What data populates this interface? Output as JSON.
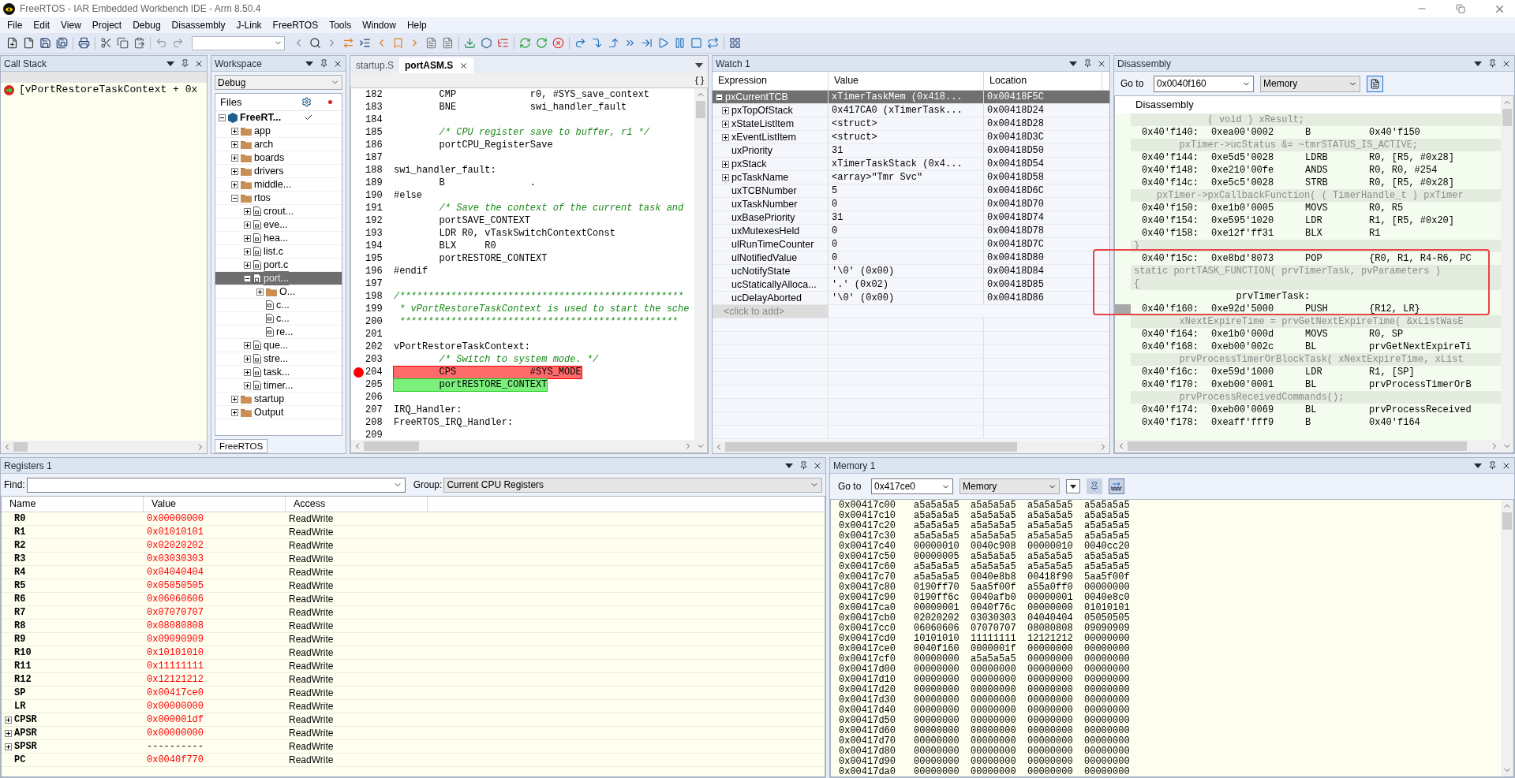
{
  "window": {
    "title": "FreeRTOS - IAR Embedded Workbench IDE - Arm 8.50.4"
  },
  "menu": [
    "File",
    "Edit",
    "View",
    "Project",
    "Debug",
    "Disassembly",
    "J-Link",
    "FreeRTOS",
    "Tools",
    "Window",
    "Help"
  ],
  "call_stack": {
    "title": "Call Stack",
    "frames": [
      "[vPortRestoreTaskContext + 0x"
    ]
  },
  "workspace": {
    "title": "Workspace",
    "config": "Debug",
    "column": "Files",
    "tab": "FreeRTOS",
    "tree": [
      {
        "label": "FreeRT...",
        "kind": "project",
        "expanded": true,
        "checked": true,
        "selected": false,
        "children": [
          {
            "label": "app",
            "kind": "folder",
            "expanded": false,
            "selected": false
          },
          {
            "label": "arch",
            "kind": "folder",
            "expanded": false,
            "selected": false
          },
          {
            "label": "boards",
            "kind": "folder",
            "expanded": false,
            "selected": false
          },
          {
            "label": "drivers",
            "kind": "folder",
            "expanded": false,
            "selected": false
          },
          {
            "label": "middle...",
            "kind": "folder",
            "expanded": false,
            "selected": false
          },
          {
            "label": "rtos",
            "kind": "folder",
            "expanded": true,
            "selected": false,
            "children": [
              {
                "label": "crout...",
                "kind": "source",
                "expanded": false,
                "selected": false
              },
              {
                "label": "eve...",
                "kind": "source",
                "expanded": false,
                "selected": false
              },
              {
                "label": "hea...",
                "kind": "source",
                "expanded": false,
                "selected": false
              },
              {
                "label": "list.c",
                "kind": "source",
                "expanded": false,
                "selected": false
              },
              {
                "label": "port.c",
                "kind": "source",
                "expanded": false,
                "selected": false
              },
              {
                "label": "port...",
                "kind": "asm",
                "expanded": true,
                "selected": true,
                "children": [
                  {
                    "label": "O...",
                    "kind": "folder",
                    "expanded": false,
                    "selected": false
                  },
                  {
                    "label": "c...",
                    "kind": "header",
                    "selected": false
                  },
                  {
                    "label": "c...",
                    "kind": "header",
                    "selected": false
                  },
                  {
                    "label": "re...",
                    "kind": "header",
                    "selected": false
                  }
                ]
              },
              {
                "label": "que...",
                "kind": "source",
                "expanded": false,
                "selected": false
              },
              {
                "label": "stre...",
                "kind": "source",
                "expanded": false,
                "selected": false
              },
              {
                "label": "task...",
                "kind": "source",
                "expanded": false,
                "selected": false
              },
              {
                "label": "timer...",
                "kind": "source",
                "expanded": false,
                "selected": false
              }
            ]
          },
          {
            "label": "startup",
            "kind": "folder",
            "expanded": false,
            "selected": false
          },
          {
            "label": "Output",
            "kind": "folder",
            "expanded": false,
            "selected": false
          }
        ]
      }
    ]
  },
  "editor": {
    "tabs": [
      {
        "label": "startup.S",
        "selected": false
      },
      {
        "label": "portASM.S",
        "selected": true
      }
    ],
    "lines": [
      {
        "num": "182",
        "kind": "code",
        "breakpoint": false,
        "text": "        CMP             r0, #SYS_save_context"
      },
      {
        "num": "183",
        "kind": "code",
        "breakpoint": false,
        "text": "        BNE             swi_handler_fault"
      },
      {
        "num": "184",
        "breakpoint": false
      },
      {
        "num": "185",
        "kind": "comment",
        "breakpoint": false,
        "text": "        /* CPU register save to buffer, r1 */"
      },
      {
        "num": "186",
        "kind": "code",
        "breakpoint": false,
        "text": "        portCPU_RegisterSave"
      },
      {
        "num": "187",
        "breakpoint": false
      },
      {
        "num": "188",
        "kind": "code",
        "breakpoint": false,
        "text": "swi_handler_fault:"
      },
      {
        "num": "189",
        "kind": "code",
        "breakpoint": false,
        "text": "        B               ."
      },
      {
        "num": "190",
        "kind": "code",
        "breakpoint": false,
        "text": "#else"
      },
      {
        "num": "191",
        "kind": "comment",
        "breakpoint": false,
        "text": "        /* Save the context of the current task and"
      },
      {
        "num": "192",
        "kind": "code",
        "breakpoint": false,
        "text": "        portSAVE_CONTEXT"
      },
      {
        "num": "193",
        "kind": "code",
        "breakpoint": false,
        "text": "        LDR R0, vTaskSwitchContextConst"
      },
      {
        "num": "194",
        "kind": "code",
        "breakpoint": false,
        "text": "        BLX     R0"
      },
      {
        "num": "195",
        "kind": "code",
        "breakpoint": false,
        "text": "        portRESTORE_CONTEXT"
      },
      {
        "num": "196",
        "kind": "code",
        "breakpoint": false,
        "text": "#endif"
      },
      {
        "num": "197",
        "breakpoint": false
      },
      {
        "num": "198",
        "kind": "comment",
        "breakpoint": false,
        "text": "/**************************************************"
      },
      {
        "num": "199",
        "kind": "comment",
        "breakpoint": false,
        "text": " * vPortRestoreTaskContext is used to start the sche"
      },
      {
        "num": "200",
        "kind": "comment",
        "breakpoint": false,
        "text": " *************************************************"
      },
      {
        "num": "201",
        "breakpoint": false
      },
      {
        "num": "202",
        "kind": "code",
        "breakpoint": false,
        "text": "vPortRestoreTaskContext:"
      },
      {
        "num": "203",
        "kind": "comment",
        "breakpoint": false,
        "text": "        /* Switch to system mode. */"
      },
      {
        "num": "204",
        "kind": "code",
        "breakpoint": true,
        "current": false,
        "text": "        CPS             #SYS_MODE"
      },
      {
        "num": "205",
        "kind": "code",
        "breakpoint": false,
        "current": true,
        "text": "        portRESTORE_CONTEXT"
      },
      {
        "num": "206",
        "breakpoint": false
      },
      {
        "num": "207",
        "kind": "code",
        "breakpoint": false,
        "text": "IRQ_Handler:"
      },
      {
        "num": "208",
        "kind": "code",
        "breakpoint": false,
        "text": "FreeRTOS_IRQ_Handler:"
      },
      {
        "num": "209",
        "breakpoint": false
      }
    ]
  },
  "watch": {
    "title": "Watch 1",
    "columns": [
      "Expression",
      "Value",
      "Location"
    ],
    "add_row": "<click to add>",
    "rows": [
      {
        "expression": "pxCurrentTCB",
        "value": "xTimerTaskMem (0x418...",
        "location": "0x00418F5C",
        "expanded": true,
        "selected": true,
        "children": [
          {
            "expression": "pxTopOfStack",
            "value": "0x417CA0 (xTimerTask...",
            "location": "0x00418D24",
            "expanded": false,
            "selected": false
          },
          {
            "expression": "xStateListItem",
            "value": "<struct>",
            "location": "0x00418D28",
            "expanded": false,
            "selected": false
          },
          {
            "expression": "xEventListItem",
            "value": "<struct>",
            "location": "0x00418D3C",
            "expanded": false,
            "selected": false
          },
          {
            "expression": "uxPriority",
            "value": "31",
            "location": "0x00418D50",
            "selected": false
          },
          {
            "expression": "pxStack",
            "value": "xTimerTaskStack (0x4...",
            "location": "0x00418D54",
            "expanded": false,
            "selected": false
          },
          {
            "expression": "pcTaskName",
            "value": "<array>\"Tmr Svc\"",
            "location": "0x00418D58",
            "expanded": false,
            "selected": false
          },
          {
            "expression": "uxTCBNumber",
            "value": "5",
            "location": "0x00418D6C",
            "selected": false
          },
          {
            "expression": "uxTaskNumber",
            "value": "0",
            "location": "0x00418D70",
            "selected": false
          },
          {
            "expression": "uxBasePriority",
            "value": "31",
            "location": "0x00418D74",
            "selected": false
          },
          {
            "expression": "uxMutexesHeld",
            "value": "0",
            "location": "0x00418D78",
            "selected": false
          },
          {
            "expression": "ulRunTimeCounter",
            "value": "0",
            "location": "0x00418D7C",
            "selected": false
          },
          {
            "expression": "ulNotifiedValue",
            "value": "0",
            "location": "0x00418D80",
            "selected": false
          },
          {
            "expression": "ucNotifyState",
            "value": "'\\0' (0x00)",
            "location": "0x00418D84",
            "selected": false
          },
          {
            "expression": "ucStaticallyAlloca...",
            "value": "'.' (0x02)",
            "location": "0x00418D85",
            "selected": false
          },
          {
            "expression": "ucDelayAborted",
            "value": "'\\0' (0x00)",
            "location": "0x00418D86",
            "selected": false
          }
        ]
      }
    ]
  },
  "disassembly": {
    "title": "Disassembly",
    "goto_label": "Go to",
    "goto": "0x0040f160",
    "zone": "Memory",
    "header": "Disassembly",
    "lines": [
      {
        "kind": "source",
        "text": "             ( void ) xResult;"
      },
      {
        "kind": "instr",
        "current": false,
        "address": "0x40'f140:",
        "opcode": "0xea00'0002",
        "mnemonic": "B",
        "operands": "0x40'f150"
      },
      {
        "kind": "source",
        "text": "        pxTimer->ucStatus &= ~tmrSTATUS_IS_ACTIVE;"
      },
      {
        "kind": "instr",
        "current": false,
        "address": "0x40'f144:",
        "opcode": "0xe5d5'0028",
        "mnemonic": "LDRB",
        "operands": "R0, [R5, #0x28]"
      },
      {
        "kind": "instr",
        "current": false,
        "address": "0x40'f148:",
        "opcode": "0xe210'00fe",
        "mnemonic": "ANDS",
        "operands": "R0, R0, #254"
      },
      {
        "kind": "instr",
        "current": false,
        "address": "0x40'f14c:",
        "opcode": "0xe5c5'0028",
        "mnemonic": "STRB",
        "operands": "R0, [R5, #0x28]"
      },
      {
        "kind": "source",
        "text": "    pxTimer->pxCallbackFunction( ( TimerHandle_t ) pxTimer"
      },
      {
        "kind": "instr",
        "current": false,
        "address": "0x40'f150:",
        "opcode": "0xe1b0'0005",
        "mnemonic": "MOVS",
        "operands": "R0, R5"
      },
      {
        "kind": "instr",
        "current": false,
        "address": "0x40'f154:",
        "opcode": "0xe595'1020",
        "mnemonic": "LDR",
        "operands": "R1, [R5, #0x20]"
      },
      {
        "kind": "instr",
        "current": false,
        "address": "0x40'f158:",
        "opcode": "0xe12f'ff31",
        "mnemonic": "BLX",
        "operands": "R1"
      },
      {
        "kind": "source",
        "text": "}"
      },
      {
        "kind": "instr",
        "current": false,
        "address": "0x40'f15c:",
        "opcode": "0xe8bd'8073",
        "mnemonic": "POP",
        "operands": "{R0, R1, R4-R6, PC"
      },
      {
        "kind": "source",
        "text": "static portTASK_FUNCTION( prvTimerTask, pvParameters )"
      },
      {
        "kind": "source",
        "text": "{"
      },
      {
        "kind": "label",
        "text": "                  prvTimerTask:"
      },
      {
        "kind": "instr",
        "current": true,
        "address": "0x40'f160:",
        "opcode": "0xe92d'5000",
        "mnemonic": "PUSH",
        "operands": "{R12, LR}"
      },
      {
        "kind": "source",
        "text": "        xNextExpireTime = prvGetNextExpireTime( &xListWasE"
      },
      {
        "kind": "instr",
        "current": false,
        "address": "0x40'f164:",
        "opcode": "0xe1b0'000d",
        "mnemonic": "MOVS",
        "operands": "R0, SP"
      },
      {
        "kind": "instr",
        "current": false,
        "address": "0x40'f168:",
        "opcode": "0xeb00'002c",
        "mnemonic": "BL",
        "operands": "prvGetNextExpireTi"
      },
      {
        "kind": "source",
        "text": "        prvProcessTimerOrBlockTask( xNextExpireTime, xList"
      },
      {
        "kind": "instr",
        "current": false,
        "address": "0x40'f16c:",
        "opcode": "0xe59d'1000",
        "mnemonic": "LDR",
        "operands": "R1, [SP]"
      },
      {
        "kind": "instr",
        "current": false,
        "address": "0x40'f170:",
        "opcode": "0xeb00'0001",
        "mnemonic": "BL",
        "operands": "prvProcessTimerOrB"
      },
      {
        "kind": "source",
        "text": "        prvProcessReceivedCommands();"
      },
      {
        "kind": "instr",
        "current": false,
        "address": "0x40'f174:",
        "opcode": "0xeb00'0069",
        "mnemonic": "BL",
        "operands": "prvProcessReceived"
      },
      {
        "kind": "instr",
        "current": false,
        "address": "0x40'f178:",
        "opcode": "0xeaff'fff9",
        "mnemonic": "B",
        "operands": "0x40'f164"
      }
    ]
  },
  "registers": {
    "title": "Registers 1",
    "find_label": "Find:",
    "group_label": "Group:",
    "group": "Current CPU Registers",
    "columns": [
      "Name",
      "Value",
      "Access"
    ],
    "rows": [
      {
        "name": "R0",
        "value": "0x00000000",
        "access": "ReadWrite",
        "changed": true
      },
      {
        "name": "R1",
        "value": "0x01010101",
        "access": "ReadWrite",
        "changed": true
      },
      {
        "name": "R2",
        "value": "0x02020202",
        "access": "ReadWrite",
        "changed": true
      },
      {
        "name": "R3",
        "value": "0x03030303",
        "access": "ReadWrite",
        "changed": true
      },
      {
        "name": "R4",
        "value": "0x04040404",
        "access": "ReadWrite",
        "changed": true
      },
      {
        "name": "R5",
        "value": "0x05050505",
        "access": "ReadWrite",
        "changed": true
      },
      {
        "name": "R6",
        "value": "0x06060606",
        "access": "ReadWrite",
        "changed": true
      },
      {
        "name": "R7",
        "value": "0x07070707",
        "access": "ReadWrite",
        "changed": true
      },
      {
        "name": "R8",
        "value": "0x08080808",
        "access": "ReadWrite",
        "changed": true
      },
      {
        "name": "R9",
        "value": "0x09090909",
        "access": "ReadWrite",
        "changed": true
      },
      {
        "name": "R10",
        "value": "0x10101010",
        "access": "ReadWrite",
        "changed": true
      },
      {
        "name": "R11",
        "value": "0x11111111",
        "access": "ReadWrite",
        "changed": true
      },
      {
        "name": "R12",
        "value": "0x12121212",
        "access": "ReadWrite",
        "changed": true
      },
      {
        "name": "SP",
        "value": "0x00417ce0",
        "access": "ReadWrite",
        "changed": true
      },
      {
        "name": "LR",
        "value": "0x00000000",
        "access": "ReadWrite",
        "changed": true
      },
      {
        "name": "CPSR",
        "value": "0x000001df",
        "access": "ReadWrite",
        "changed": true,
        "expanded": false
      },
      {
        "name": "APSR",
        "value": "0x00000000",
        "access": "ReadWrite",
        "changed": true,
        "expanded": false
      },
      {
        "name": "SPSR",
        "value": "----------",
        "access": "ReadWrite",
        "changed": false,
        "expanded": false
      },
      {
        "name": "PC",
        "value": "0x0040f770",
        "access": "ReadWrite",
        "changed": true
      }
    ]
  },
  "memory": {
    "title": "Memory 1",
    "goto_label": "Go to",
    "goto": "0x417ce0",
    "zone": "Memory",
    "rows": [
      {
        "address": "0x00417c00",
        "words": [
          "a5a5a5a5",
          "a5a5a5a5",
          "a5a5a5a5",
          "a5a5a5a5"
        ]
      },
      {
        "address": "0x00417c10",
        "words": [
          "a5a5a5a5",
          "a5a5a5a5",
          "a5a5a5a5",
          "a5a5a5a5"
        ]
      },
      {
        "address": "0x00417c20",
        "words": [
          "a5a5a5a5",
          "a5a5a5a5",
          "a5a5a5a5",
          "a5a5a5a5"
        ]
      },
      {
        "address": "0x00417c30",
        "words": [
          "a5a5a5a5",
          "a5a5a5a5",
          "a5a5a5a5",
          "a5a5a5a5"
        ]
      },
      {
        "address": "0x00417c40",
        "words": [
          "00000010",
          "0040c908",
          "00000010",
          "0040cc20"
        ]
      },
      {
        "address": "0x00417c50",
        "words": [
          "00000005",
          "a5a5a5a5",
          "a5a5a5a5",
          "a5a5a5a5"
        ]
      },
      {
        "address": "0x00417c60",
        "words": [
          "a5a5a5a5",
          "a5a5a5a5",
          "a5a5a5a5",
          "a5a5a5a5"
        ]
      },
      {
        "address": "0x00417c70",
        "words": [
          "a5a5a5a5",
          "0040e8b8",
          "00418f90",
          "5aa5f00f"
        ]
      },
      {
        "address": "0x00417c80",
        "words": [
          "0190ff70",
          "5aa5f00f",
          "a55a0ff0",
          "00000000"
        ]
      },
      {
        "address": "0x00417c90",
        "words": [
          "0190ff6c",
          "0040afb0",
          "00000001",
          "0040e8c0"
        ]
      },
      {
        "address": "0x00417ca0",
        "words": [
          "00000001",
          "0040f76c",
          "00000000",
          "01010101"
        ]
      },
      {
        "address": "0x00417cb0",
        "words": [
          "02020202",
          "03030303",
          "04040404",
          "05050505"
        ]
      },
      {
        "address": "0x00417cc0",
        "words": [
          "06060606",
          "07070707",
          "08080808",
          "09090909"
        ]
      },
      {
        "address": "0x00417cd0",
        "words": [
          "10101010",
          "11111111",
          "12121212",
          "00000000"
        ]
      },
      {
        "address": "0x00417ce0",
        "words": [
          "0040f160",
          "0000001f",
          "00000000",
          "00000000"
        ]
      },
      {
        "address": "0x00417cf0",
        "words": [
          "00000000",
          "a5a5a5a5",
          "00000000",
          "00000000"
        ]
      },
      {
        "address": "0x00417d00",
        "words": [
          "00000000",
          "00000000",
          "00000000",
          "00000000"
        ]
      },
      {
        "address": "0x00417d10",
        "words": [
          "00000000",
          "00000000",
          "00000000",
          "00000000"
        ]
      },
      {
        "address": "0x00417d20",
        "words": [
          "00000000",
          "00000000",
          "00000000",
          "00000000"
        ]
      },
      {
        "address": "0x00417d30",
        "words": [
          "00000000",
          "00000000",
          "00000000",
          "00000000"
        ]
      },
      {
        "address": "0x00417d40",
        "words": [
          "00000000",
          "00000000",
          "00000000",
          "00000000"
        ]
      },
      {
        "address": "0x00417d50",
        "words": [
          "00000000",
          "00000000",
          "00000000",
          "00000000"
        ]
      },
      {
        "address": "0x00417d60",
        "words": [
          "00000000",
          "00000000",
          "00000000",
          "00000000"
        ]
      },
      {
        "address": "0x00417d70",
        "words": [
          "00000000",
          "00000000",
          "00000000",
          "00000000"
        ]
      },
      {
        "address": "0x00417d80",
        "words": [
          "00000000",
          "00000000",
          "00000000",
          "00000000"
        ]
      },
      {
        "address": "0x00417d90",
        "words": [
          "00000000",
          "00000000",
          "00000000",
          "00000000"
        ]
      },
      {
        "address": "0x00417da0",
        "words": [
          "00000000",
          "00000000",
          "00000000",
          "00000000"
        ]
      }
    ]
  }
}
